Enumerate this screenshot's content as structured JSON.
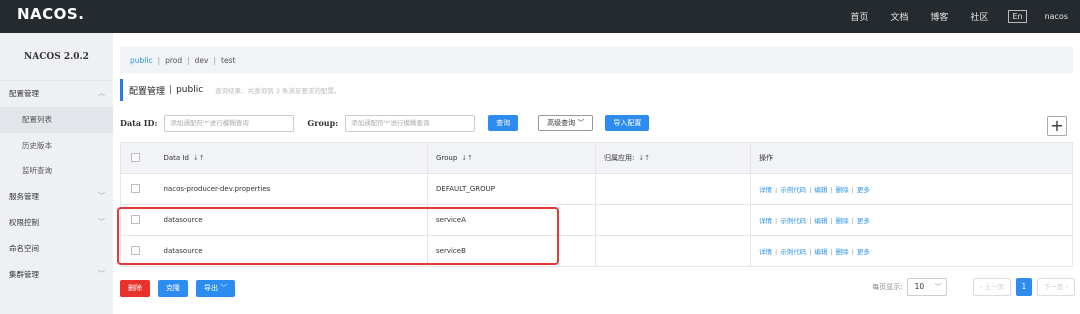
{
  "header": {
    "logo": "NACOS.",
    "nav": [
      "首页",
      "文档",
      "博客",
      "社区"
    ],
    "lang": "En",
    "user": "nacos"
  },
  "sidebar": {
    "title": "NACOS 2.0.2",
    "items": [
      {
        "label": "配置管理",
        "expanded": true
      },
      {
        "label": "配置列表",
        "sub": true,
        "active": true
      },
      {
        "label": "历史版本",
        "sub": true
      },
      {
        "label": "监听查询",
        "sub": true
      },
      {
        "label": "服务管理",
        "expanded": false
      },
      {
        "label": "权限控制",
        "expanded": false
      },
      {
        "label": "命名空间"
      },
      {
        "label": "集群管理",
        "expanded": false
      }
    ]
  },
  "namespaces": {
    "items": [
      "public",
      "prod",
      "dev",
      "test"
    ],
    "active": "public",
    "separator": "|"
  },
  "section": {
    "title": "配置管理",
    "separator": "|",
    "namespace": "public",
    "hint": "查询结果：共查询到 3 条满足要求的配置。"
  },
  "filter": {
    "data_id_label": "Data ID:",
    "data_id_placeholder": "添加通配符'*'进行模糊查询",
    "group_label": "Group:",
    "group_placeholder": "添加通配符'*'进行模糊查询",
    "query_button": "查询",
    "advanced_button": "高级查询",
    "import_button": "导入配置",
    "add_button": "+"
  },
  "table": {
    "columns": [
      "Data Id",
      "Group",
      "归属应用:",
      "操作"
    ],
    "rows": [
      {
        "data_id": "nacos-producer-dev.properties",
        "group": "DEFAULT_GROUP",
        "app": ""
      },
      {
        "data_id": "datasource",
        "group": "serviceA",
        "app": ""
      },
      {
        "data_id": "datasource",
        "group": "serviceB",
        "app": ""
      }
    ],
    "operations": [
      "详情",
      "示例代码",
      "编辑",
      "删除",
      "更多"
    ],
    "op_separator": "|"
  },
  "bottom": {
    "delete_button": "删除",
    "clone_button": "克隆",
    "export_button": "导出"
  },
  "pager": {
    "page_size_label": "每页显示:",
    "page_size": "10",
    "prev": "上一页",
    "current_page": "1",
    "next": "下一页"
  },
  "colors": {
    "header_bg": "#252a2f",
    "accent": "#2d8cf0",
    "danger": "#e8322a",
    "highlight_box": "#e53935"
  }
}
